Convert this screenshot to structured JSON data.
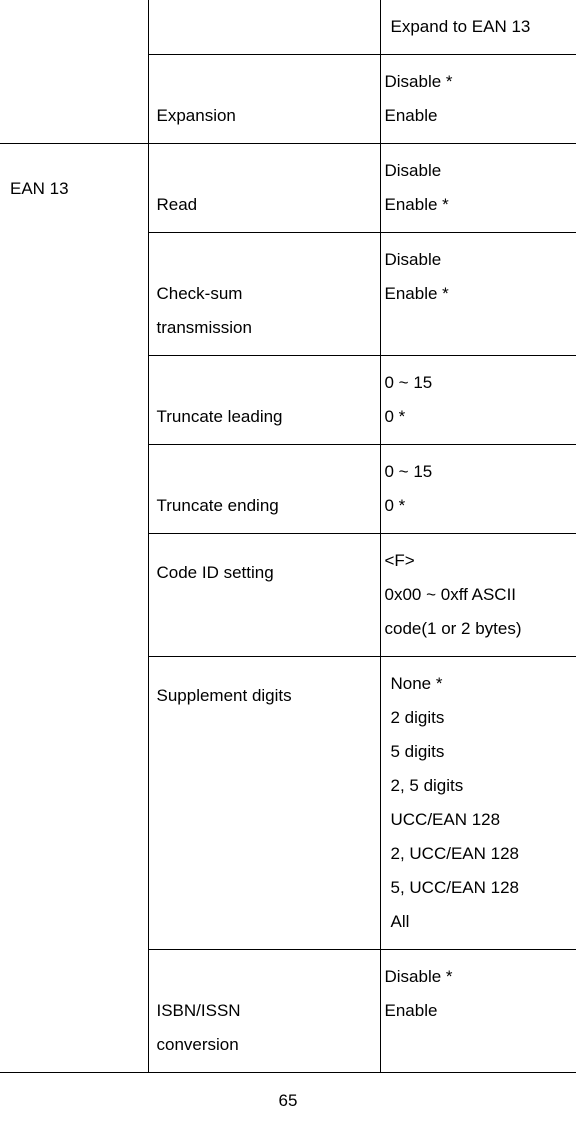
{
  "page_number": "65",
  "groups": [
    {
      "name": "",
      "rows": [
        {
          "label": "",
          "label_pos": "top",
          "options_indent": true,
          "options": [
            "Expand to EAN 13"
          ]
        },
        {
          "label": "Expansion",
          "label_pos": "low",
          "options_indent": false,
          "options": [
            "Disable *",
            "Enable"
          ]
        }
      ]
    },
    {
      "name": "EAN 13",
      "rows": [
        {
          "label": "Read",
          "label_pos": "low",
          "options_indent": false,
          "options": [
            "Disable",
            "Enable *"
          ]
        },
        {
          "label": "Check-sum transmission",
          "label_pos": "low",
          "label_lines": [
            "Check-sum",
            "transmission"
          ],
          "options_indent": false,
          "options": [
            "Disable",
            "Enable *"
          ]
        },
        {
          "label": "Truncate leading",
          "label_pos": "low",
          "options_indent": false,
          "options": [
            "0 ~ 15",
            "0 *"
          ]
        },
        {
          "label": "Truncate ending",
          "label_pos": "low",
          "options_indent": false,
          "options": [
            "0 ~ 15",
            "0 *"
          ]
        },
        {
          "label": "Code ID setting",
          "label_pos": "mid",
          "options_indent": false,
          "options": [
            "<F>",
            "0x00 ~ 0xff ASCII",
            "code(1 or 2 bytes)"
          ]
        },
        {
          "label": "Supplement digits",
          "label_pos": "mid",
          "options_indent": true,
          "options": [
            "None *",
            "2 digits",
            "5 digits",
            "2, 5 digits",
            "UCC/EAN 128",
            "2, UCC/EAN 128",
            "5, UCC/EAN 128",
            "All"
          ]
        },
        {
          "label": "ISBN/ISSN conversion",
          "label_pos": "low",
          "label_lines": [
            "ISBN/ISSN",
            "conversion"
          ],
          "options_indent": false,
          "options": [
            "Disable *",
            "Enable"
          ]
        }
      ]
    }
  ]
}
